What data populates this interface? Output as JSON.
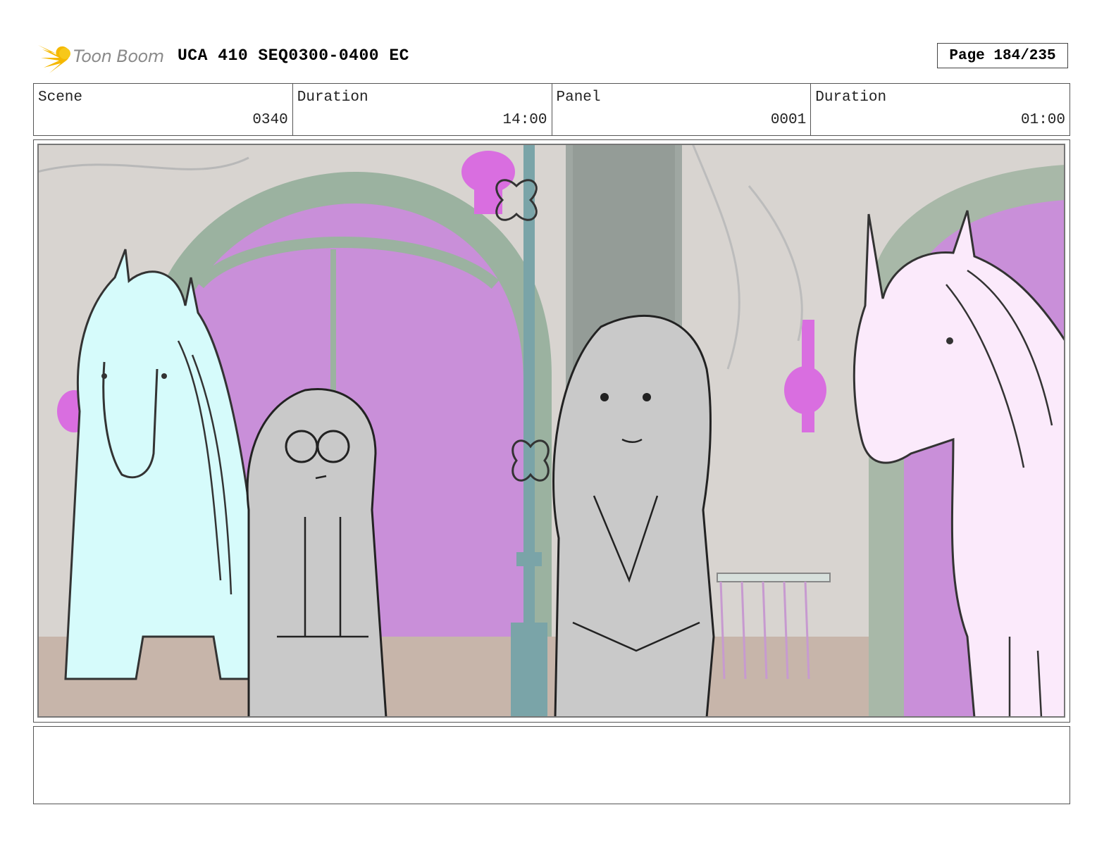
{
  "header": {
    "logo_text": "Toon Boom",
    "title": "UCA 410 SEQ0300-0400 EC",
    "page_label": "Page 184/235"
  },
  "info": {
    "scene_label": "Scene",
    "scene_value": "0340",
    "scene_duration_label": "Duration",
    "scene_duration_value": "14:00",
    "panel_label": "Panel",
    "panel_value": "0001",
    "panel_duration_label": "Duration",
    "panel_duration_value": "01:00"
  },
  "notes": {
    "text": ""
  },
  "colors": {
    "logo_flame": "#f5b800",
    "archway_green": "#9bb2a0",
    "window_purple": "#c98fd9",
    "lamp_magenta": "#d96ee0",
    "unicorn_left": "#d6fbfb",
    "unicorn_right": "#fbeafb",
    "character_fill": "#c9c9c9",
    "background_wall": "#d8d4d0",
    "floor": "#c7b5aa"
  }
}
